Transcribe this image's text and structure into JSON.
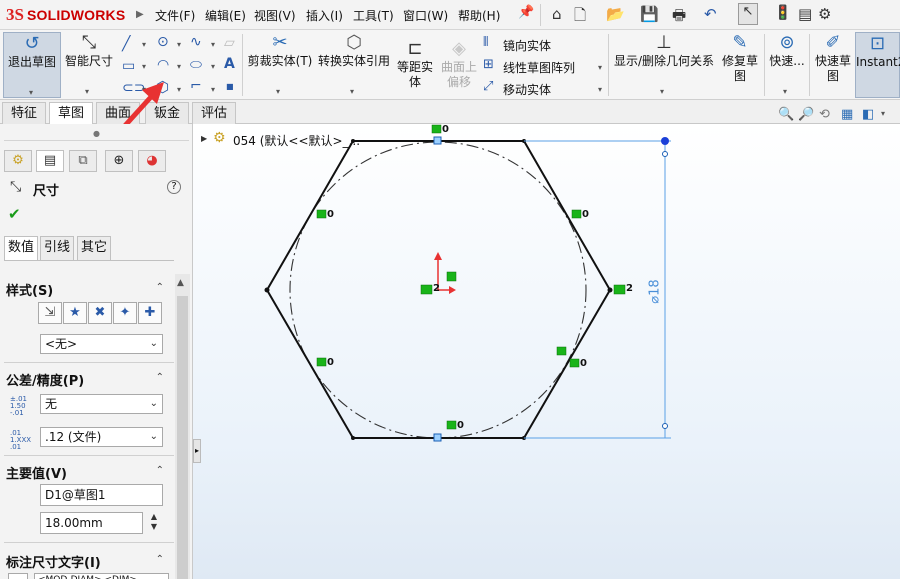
{
  "app": {
    "logo_ds": "3S",
    "logo_text": "SOLIDWORKS"
  },
  "menu": [
    "文件(F)",
    "编辑(E)",
    "视图(V)",
    "插入(I)",
    "工具(T)",
    "窗口(W)",
    "帮助(H)"
  ],
  "ribbon": {
    "exit_sketch": "退出草图",
    "smart_dim": "智能尺寸",
    "trim": "剪裁实体(T)",
    "convert": "转换实体引用",
    "offset_line1": "等距实",
    "offset_line2": "体",
    "offset_surface_line1": "曲面上",
    "offset_surface_line2": "偏移",
    "mirror": "镜向实体",
    "linear_pattern": "线性草图阵列",
    "move": "移动实体",
    "display_relations": "显示/删除几何关系",
    "repair_line1": "修复草",
    "repair_line2": "图",
    "quick_snaps": "快速...",
    "rapid_line1": "快速草",
    "rapid_line2": "图",
    "instant2d": "Instant2"
  },
  "tabs": [
    "特征",
    "草图",
    "曲面",
    "钣金",
    "评估"
  ],
  "tree": {
    "node": "054 (默认<<默认>_..."
  },
  "panel": {
    "title": "尺寸",
    "subtabs": [
      "数值",
      "引线",
      "其它"
    ],
    "style_label": "样式(S)",
    "style_value": "<无>",
    "tolerance_label": "公差/精度(P)",
    "tolerance_value": "无",
    "precision_value": ".12 (文件)",
    "primary_label": "主要值(V)",
    "dim_name": "D1@草图1",
    "dim_value": "18.00mm",
    "dim_text_label": "标注尺寸文字(I)",
    "dim_text_partial": "<MOD-DIAM> <DIM>"
  },
  "sketch": {
    "relation_label": "0",
    "center_relation_label": "2",
    "right_relation_label": "2",
    "dimension_text": "⌀18"
  },
  "colors": {
    "accent": "#2a6bb4",
    "relation_green": "#19b419",
    "annotation_red": "#e83232"
  }
}
